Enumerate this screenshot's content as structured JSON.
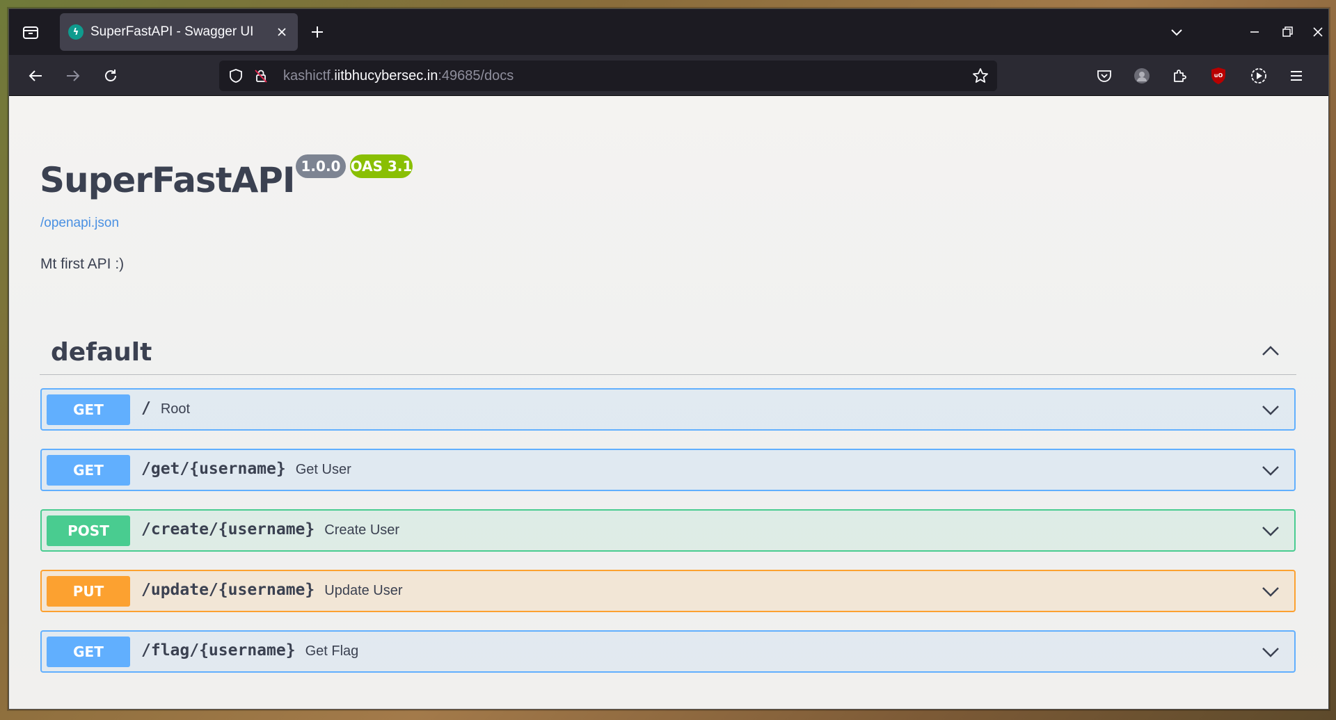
{
  "browser": {
    "tab": {
      "title": "SuperFastAPI - Swagger UI",
      "favicon": "fastapi-bolt-icon"
    },
    "url": {
      "prefix": "kashictf.",
      "host": "iitbhucybersec.in",
      "suffix": ":49685/docs"
    }
  },
  "page": {
    "title": "SuperFastAPI",
    "version_badge": "1.0.0",
    "oas_badge": "OAS 3.1",
    "openapi_link": "/openapi.json",
    "description": "Mt first API :)"
  },
  "section": {
    "title": "default",
    "expanded": true
  },
  "operations": [
    {
      "method": "GET",
      "path": "/",
      "summary": "Root"
    },
    {
      "method": "GET",
      "path": "/get/{username}",
      "summary": "Get User"
    },
    {
      "method": "POST",
      "path": "/create/{username}",
      "summary": "Create User"
    },
    {
      "method": "PUT",
      "path": "/update/{username}",
      "summary": "Update User"
    },
    {
      "method": "GET",
      "path": "/flag/{username}",
      "summary": "Get Flag"
    }
  ],
  "colors": {
    "get": "#61affe",
    "post": "#49cc90",
    "put": "#fca130",
    "version_badge": "#7d8492",
    "oas_badge": "#89bf04",
    "link": "#4990e2",
    "text": "#3b4151"
  }
}
